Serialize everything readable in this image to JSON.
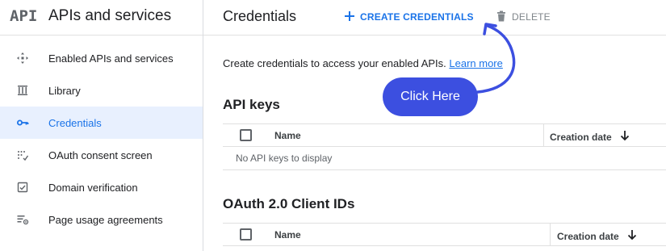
{
  "sidebar": {
    "logo_text": "API",
    "title": "APIs and services",
    "items": [
      {
        "label": "Enabled APIs and services",
        "icon": "enabled-apis-icon",
        "active": false
      },
      {
        "label": "Library",
        "icon": "library-icon",
        "active": false
      },
      {
        "label": "Credentials",
        "icon": "key-icon",
        "active": true
      },
      {
        "label": "OAuth consent screen",
        "icon": "oauth-consent-icon",
        "active": false
      },
      {
        "label": "Domain verification",
        "icon": "domain-verification-icon",
        "active": false
      },
      {
        "label": "Page usage agreements",
        "icon": "page-usage-icon",
        "active": false
      }
    ]
  },
  "header": {
    "title": "Credentials",
    "create_label": "CREATE CREDENTIALS",
    "delete_label": "DELETE"
  },
  "intro": {
    "text": "Create credentials to access your enabled APIs.",
    "link": "Learn more"
  },
  "api_keys": {
    "title": "API keys",
    "col_name": "Name",
    "col_date": "Creation date",
    "empty": "No API keys to display"
  },
  "oauth": {
    "title": "OAuth 2.0 Client IDs",
    "col_name": "Name",
    "col_date": "Creation date"
  },
  "annotation": {
    "label": "Click Here"
  },
  "colors": {
    "accent": "#1a73e8",
    "active_bg": "#e8f0fe",
    "callout": "#3c4fe0"
  }
}
